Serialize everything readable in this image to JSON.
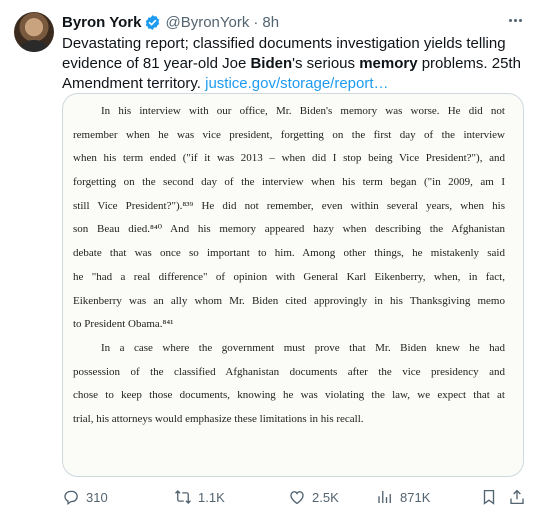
{
  "author": {
    "name": "Byron York",
    "handle": "@ByronYork",
    "separator": "·",
    "time": "8h"
  },
  "tweet": {
    "text_1": "Devastating report; classified documents investigation yields telling evidence of 81 year-old Joe ",
    "bold_1": "Biden",
    "text_2": "'s serious ",
    "bold_2": "memory",
    "text_3": " problems. 25th Amendment territory. ",
    "link": "justice.gov/storage/report…"
  },
  "document": {
    "paragraph_1": [
      "In his interview with our office, Mr. Biden's memory was worse. He did not",
      "remember when he was vice president, forgetting on the first day of the interview",
      "when his term ended (\"if it was 2013 – when did I stop being Vice President?\"), and",
      "forgetting on the second day of the interview when his term began (\"in 2009, am I",
      "still Vice President?\").⁸³⁹ He did not remember, even within several years, when his",
      "son Beau died.⁸⁴⁰ And his memory appeared hazy when describing the Afghanistan",
      "debate that was once so important to him. Among other things, he mistakenly said",
      "he \"had a real difference\" of opinion with General Karl Eikenberry, when, in fact,",
      "Eikenberry was an ally whom Mr. Biden cited approvingly in his Thanksgiving memo",
      "to President Obama.⁸⁴¹"
    ],
    "paragraph_2": [
      "In a case where the government must prove that Mr. Biden knew he had",
      "possession of the classified Afghanistan documents after the vice presidency and",
      "chose to keep those documents, knowing he was violating the law, we expect that at",
      "trial, his attorneys would emphasize these limitations in his recall."
    ]
  },
  "actions": {
    "replies": "310",
    "reposts": "1.1K",
    "likes": "2.5K",
    "views": "871K"
  },
  "icons": [
    "verified-badge-icon",
    "more-icon",
    "reply-icon",
    "repost-icon",
    "like-icon",
    "views-icon",
    "bookmark-icon",
    "share-icon"
  ],
  "colors": {
    "accent": "#1d9bf0",
    "muted": "#536471",
    "text": "#0f1419",
    "border": "#cfd9de"
  }
}
